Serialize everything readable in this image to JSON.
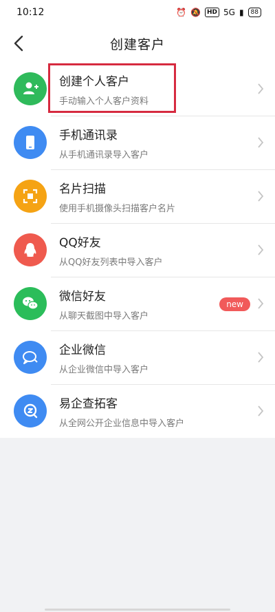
{
  "status": {
    "time": "10:12",
    "hd": "HD",
    "signal": "5G",
    "battery": "88"
  },
  "header": {
    "title": "创建客户"
  },
  "items": [
    {
      "name": "创建个人客户",
      "sub": "手动输入个人客户资料",
      "color": "#2fba5b",
      "icon": "add-person-icon"
    },
    {
      "name": "手机通讯录",
      "sub": "从手机通讯录导入客户",
      "color": "#3f8bf2",
      "icon": "phone-icon"
    },
    {
      "name": "名片扫描",
      "sub": "使用手机摄像头扫描客户名片",
      "color": "#f5a314",
      "icon": "scan-icon"
    },
    {
      "name": "QQ好友",
      "sub": "从QQ好友列表中导入客户",
      "color": "#ef5a4e",
      "icon": "qq-icon"
    },
    {
      "name": "微信好友",
      "sub": "从聊天截图中导入客户",
      "color": "#2bbd5a",
      "icon": "wechat-icon",
      "badge": "new"
    },
    {
      "name": "企业微信",
      "sub": "从企业微信中导入客户",
      "color": "#3f8bf2",
      "icon": "wecom-icon"
    },
    {
      "name": "易企查拓客",
      "sub": "从全网公开企业信息中导入客户",
      "color": "#3f8bf2",
      "icon": "yiqicha-icon"
    }
  ]
}
